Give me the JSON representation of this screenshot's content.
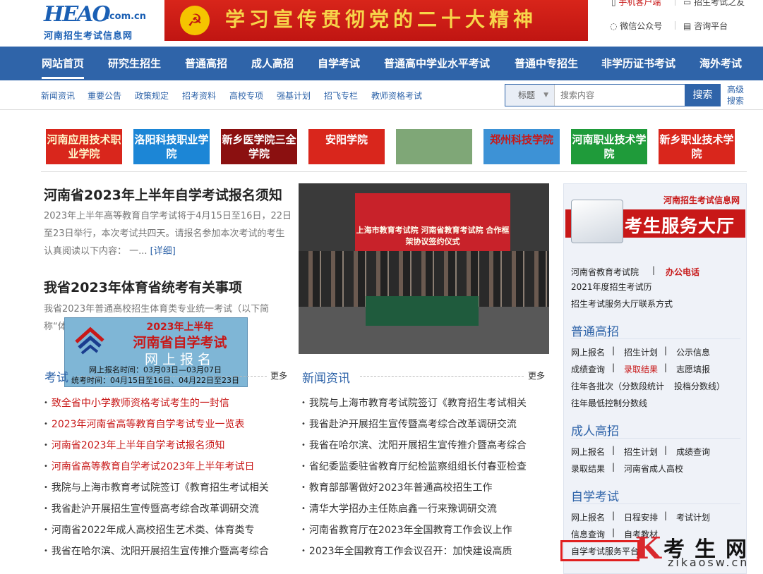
{
  "logo": {
    "mark": "HEAO",
    "domain": ".com.cn",
    "name": "河南招生考试信息网"
  },
  "banner": {
    "text": "学习宣传贯彻党的二十大精神"
  },
  "toplinks": [
    "手机客户端",
    "招生考试之友",
    "微信公众号",
    "咨询平台"
  ],
  "nav": [
    "网站首页",
    "研究生招生",
    "普通高招",
    "成人高招",
    "自学考试",
    "普通高中学业水平考试",
    "普通中专招生",
    "非学历证书考试",
    "海外考试"
  ],
  "subnav": [
    "新闻资讯",
    "重要公告",
    "政策规定",
    "招考资料",
    "高校专项",
    "强基计划",
    "招飞专栏",
    "教师资格考试"
  ],
  "search": {
    "select": "标题",
    "placeholder": "搜索内容",
    "button": "搜索",
    "advanced": "高级搜索"
  },
  "schools": [
    {
      "name": "河南应用技术职业学院",
      "bg": "#d9261c",
      "fg": "#fff6c8"
    },
    {
      "name": "洛阳科技职业学院",
      "bg": "#1c86d6",
      "fg": "#fff"
    },
    {
      "name": "新乡医学院三全学院",
      "bg": "#8b1010",
      "fg": "#fff"
    },
    {
      "name": "安阳学院",
      "bg": "#d9261c",
      "fg": "#fff"
    },
    {
      "name": "",
      "bg": "#7fa777",
      "fg": "#fff"
    },
    {
      "name": "郑州科技学院",
      "bg": "#3d92d6",
      "fg": "#c81818"
    },
    {
      "name": "河南职业技术学院",
      "bg": "#1f9b3a",
      "fg": "#fff"
    },
    {
      "name": "新乡职业技术学院",
      "bg": "#d9261c",
      "fg": "#fff"
    }
  ],
  "headline1": {
    "title": "河南省2023年上半年自学考试报名须知",
    "body": "2023年上半年高等教育自学考试将于4月15日至16日，22日至23日举行，本次考试共四天。请报名参加本次考试的考生认真阅读以下内容： 一...",
    "more": "[详细]"
  },
  "headline2": {
    "title": "我省2023年体育省统考有关事项",
    "body": "我省2023年普通高校招生体育类专业统一考试（以下简称“体...考试有关事项..."
  },
  "photo": {
    "caption": "上海市教育考试院 河南省教育考试院 合作框架协议签约仪式"
  },
  "ad": {
    "l1": "2023年上半年",
    "l2": "河南省自学考试",
    "l3": "网上报名",
    "l4": "网上报名时间：03月03日—03月07日",
    "l5": "统考时间：04月15日至16日、04月22日至23日"
  },
  "col1": {
    "title": "考试",
    "more": "更多",
    "items": [
      "致全省中小学教师资格考试考生的一封信",
      "2023年河南省高等教育自学考试专业一览表",
      "河南省2023年上半年自学考试报名须知",
      "河南省高等教育自学考试2023年上半年考试日",
      "我院与上海市教育考试院签订《教育招生考试相关",
      "我省赴沪开展招生宣传暨高考综合改革调研交流",
      "河南省2022年成人高校招生艺术类、体育类专",
      "我省在哈尔滨、沈阳开展招生宣传推介暨高考综合"
    ]
  },
  "col2": {
    "title": "新闻资讯",
    "more": "更多",
    "items": [
      "我院与上海市教育考试院签订《教育招生考试相关",
      "我省赴沪开展招生宣传暨高考综合改革调研交流",
      "我省在哈尔滨、沈阳开展招生宣传推介暨高考综合",
      "省纪委监委驻省教育厅纪检监察组组长付春亚检查",
      "教育部部署做好2023年普通高校招生工作",
      "清华大学招办主任陈启鑫一行来豫调研交流",
      "河南省教育厅在2023年全国教育工作会议上作",
      "2023年全国教育工作会议召开：加快建设高质"
    ]
  },
  "sidebar": {
    "site": "河南招生考试信息网",
    "banner": "考生服务大厅",
    "office": "河南省教育考试院",
    "phone": "办公电话",
    "calendar": "2021年度招生考试历",
    "contact": "招生考试服务大厅联系方式",
    "s1": {
      "title": "普通高招",
      "links": [
        "网上报名",
        "招生计划",
        "公示信息",
        "成绩查询",
        "录取结果",
        "志愿填报",
        "往年各批次（分数段统计",
        "投档分数线）",
        "往年最低控制分数线"
      ]
    },
    "s2": {
      "title": "成人高招",
      "links": [
        "网上报名",
        "招生计划",
        "成绩查询",
        "录取结果",
        "河南省成人高校"
      ]
    },
    "s3": {
      "title": "自学考试",
      "links": [
        "网上报名",
        "日程安排",
        "考试计划",
        "信息查询",
        "自考教材",
        "自学考试服务平台"
      ]
    }
  },
  "watermark": {
    "cn": "考生网",
    "en": "zikaosw.cn"
  }
}
